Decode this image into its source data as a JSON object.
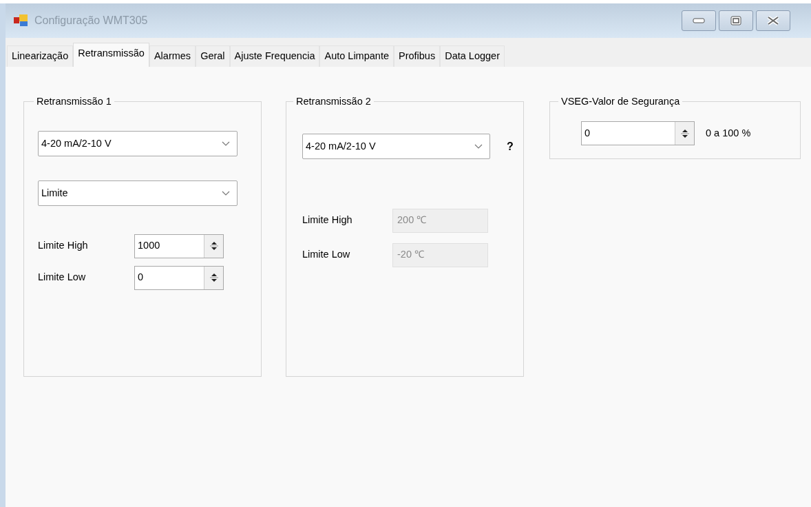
{
  "window": {
    "title": "Configuração WMT305"
  },
  "tabs": [
    {
      "label": "Linearização",
      "selected": false
    },
    {
      "label": "Retransmissão",
      "selected": true
    },
    {
      "label": "Alarmes",
      "selected": false
    },
    {
      "label": "Geral",
      "selected": false
    },
    {
      "label": "Ajuste Frequencia",
      "selected": false
    },
    {
      "label": "Auto Limpante",
      "selected": false
    },
    {
      "label": "Profibus",
      "selected": false
    },
    {
      "label": "Data Logger",
      "selected": false
    }
  ],
  "groups": [
    {
      "title": "Retransmissão 1",
      "combos": [
        {
          "value": "4-20 mA/2-10 V"
        },
        {
          "value": "Limite"
        }
      ],
      "fields": [
        {
          "label": "Limite High",
          "kind": "spin",
          "value": "1000",
          "disabled": false
        },
        {
          "label": "Limite Low",
          "kind": "spin",
          "value": "0",
          "disabled": false
        }
      ]
    },
    {
      "title": "Retransmissão 2",
      "combos": [
        {
          "value": "4-20 mA/2-10 V",
          "help": "?"
        }
      ],
      "fields": [
        {
          "label": "Limite High",
          "kind": "text",
          "value": "200 ℃",
          "disabled": true
        },
        {
          "label": "Limite Low",
          "kind": "text",
          "value": "-20 ℃",
          "disabled": true
        }
      ]
    }
  ],
  "safety": {
    "title": "VSEG-Valor de Segurança",
    "value": "0",
    "range": "0 a 100 %"
  }
}
